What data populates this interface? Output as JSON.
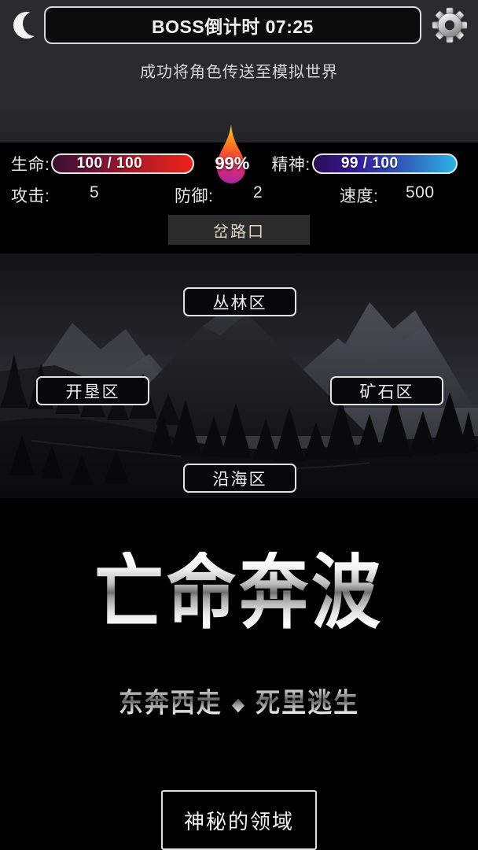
{
  "header": {
    "moon_icon": "crescent-moon-icon",
    "timer_label": "BOSS倒计时 07:25",
    "gear_icon": "gear-icon",
    "message": "成功将角色传送至模拟世界"
  },
  "stats": {
    "hp": {
      "label": "生命:",
      "value": "100 / 100",
      "color_start": "#3a1030",
      "color_end": "#ee2218"
    },
    "fuel": {
      "value": "99%",
      "icon": "flame-icon",
      "color_start": "#ffb300",
      "color_end": "#c0219e"
    },
    "sp": {
      "label": "精神:",
      "value": "99 / 100",
      "color_start": "#2a0d52",
      "color_end": "#2cb3e8"
    },
    "attack": {
      "label": "攻击:",
      "value": "5"
    },
    "defense": {
      "label": "防御:",
      "value": "2"
    },
    "speed": {
      "label": "速度:",
      "value": "500"
    },
    "location_button": "岔路口"
  },
  "map": {
    "regions": [
      {
        "label": "丛林区",
        "position": "top"
      },
      {
        "label": "开垦区",
        "position": "left"
      },
      {
        "label": "矿石区",
        "position": "right"
      },
      {
        "label": "沿海区",
        "position": "bottom"
      }
    ]
  },
  "logo": {
    "title": "亡命奔波",
    "subtitle_left": "东奔西走",
    "subtitle_separator": "◆",
    "subtitle_right": "死里逃生"
  },
  "footer": {
    "mystery_button": "神秘的领域"
  }
}
